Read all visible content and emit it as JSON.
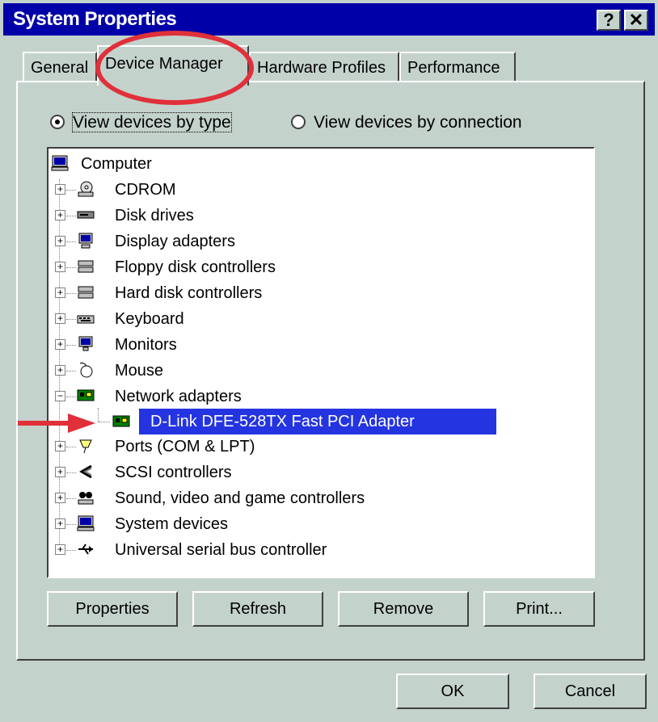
{
  "window": {
    "title": "System Properties",
    "help_label": "?",
    "close_label": "✕"
  },
  "tabs": [
    {
      "label": "General"
    },
    {
      "label": "Device Manager"
    },
    {
      "label": "Hardware Profiles"
    },
    {
      "label": "Performance"
    }
  ],
  "view": {
    "by_type_label": "View devices by type",
    "by_connection_label": "View devices by connection"
  },
  "tree": {
    "root": "Computer",
    "items": [
      {
        "label": "CDROM"
      },
      {
        "label": "Disk drives"
      },
      {
        "label": "Display adapters"
      },
      {
        "label": "Floppy disk controllers"
      },
      {
        "label": "Hard disk controllers"
      },
      {
        "label": "Keyboard"
      },
      {
        "label": "Monitors"
      },
      {
        "label": "Mouse"
      },
      {
        "label": "Network adapters"
      },
      {
        "label": "D-Link DFE-528TX Fast PCI Adapter"
      },
      {
        "label": "Ports (COM & LPT)"
      },
      {
        "label": "SCSI controllers"
      },
      {
        "label": "Sound, video and game controllers"
      },
      {
        "label": "System devices"
      },
      {
        "label": "Universal serial bus controller"
      }
    ]
  },
  "buttons": {
    "properties": "Properties",
    "refresh": "Refresh",
    "remove": "Remove",
    "print": "Print...",
    "ok": "OK",
    "cancel": "Cancel"
  },
  "colors": {
    "face": "#c4d2cc",
    "titlebar": "#0000a8",
    "selection": "#2434e0",
    "annotation": "#e0303a"
  }
}
